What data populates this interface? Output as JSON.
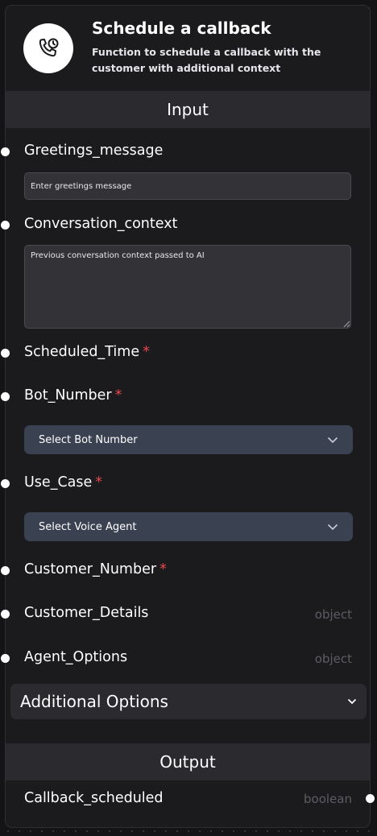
{
  "header": {
    "title": "Schedule a callback",
    "description": "Function to schedule a callback with the customer with additional context",
    "icon": "phone-clock-icon"
  },
  "input_section": {
    "label": "Input"
  },
  "fields": {
    "greetings": {
      "label": "Greetings_message",
      "placeholder": "Enter greetings message"
    },
    "conversation": {
      "label": "Conversation_context",
      "placeholder": "Previous conversation context passed to AI"
    },
    "scheduled_time": {
      "label": "Scheduled_Time",
      "required_mark": "*"
    },
    "bot_number": {
      "label": "Bot_Number",
      "required_mark": "*",
      "select_value": "Select Bot Number"
    },
    "use_case": {
      "label": "Use_Case",
      "required_mark": "*",
      "select_value": "Select Voice Agent"
    },
    "customer_number": {
      "label": "Customer_Number",
      "required_mark": "*"
    },
    "customer_details": {
      "label": "Customer_Details",
      "type": "object"
    },
    "agent_options": {
      "label": "Agent_Options",
      "type": "object"
    }
  },
  "additional_options": {
    "label": "Additional Options"
  },
  "output_section": {
    "label": "Output"
  },
  "outputs": {
    "callback_scheduled": {
      "label": "Callback_scheduled",
      "type": "boolean"
    }
  },
  "colors": {
    "background": "#141416",
    "node": "#1b1b1e",
    "section_bar": "#2a2a2f",
    "select": "#3a4150",
    "required": "#e5484d",
    "type_tag": "#5c5c63"
  }
}
